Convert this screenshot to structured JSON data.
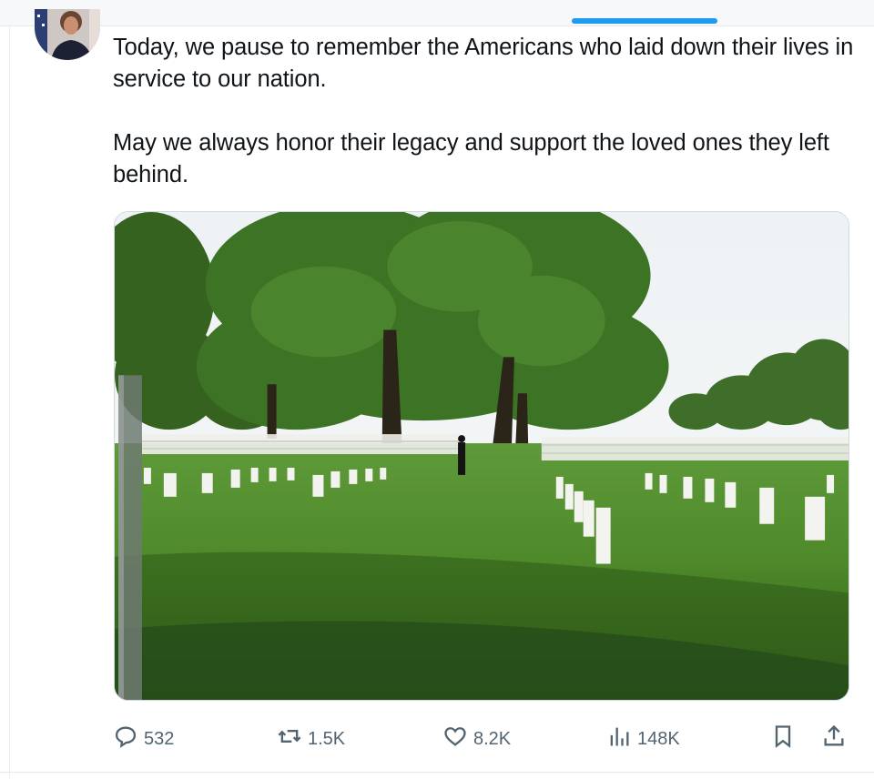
{
  "post": {
    "paragraphs": [
      "Today, we pause to remember the Americans who laid down their lives in service to our nation.",
      "May we always honor their legacy and support the loved ones they left behind."
    ]
  },
  "actions": {
    "replies": "532",
    "reposts": "1.5K",
    "likes": "8.2K",
    "views": "148K"
  },
  "icons": {
    "reply": "reply-icon",
    "repost": "repost-icon",
    "like": "heart-icon",
    "views": "analytics-icon",
    "bookmark": "bookmark-icon",
    "share": "share-icon"
  },
  "colors": {
    "accent": "#1d9bf0",
    "icon_gray": "#536471",
    "text": "#0f1419"
  }
}
